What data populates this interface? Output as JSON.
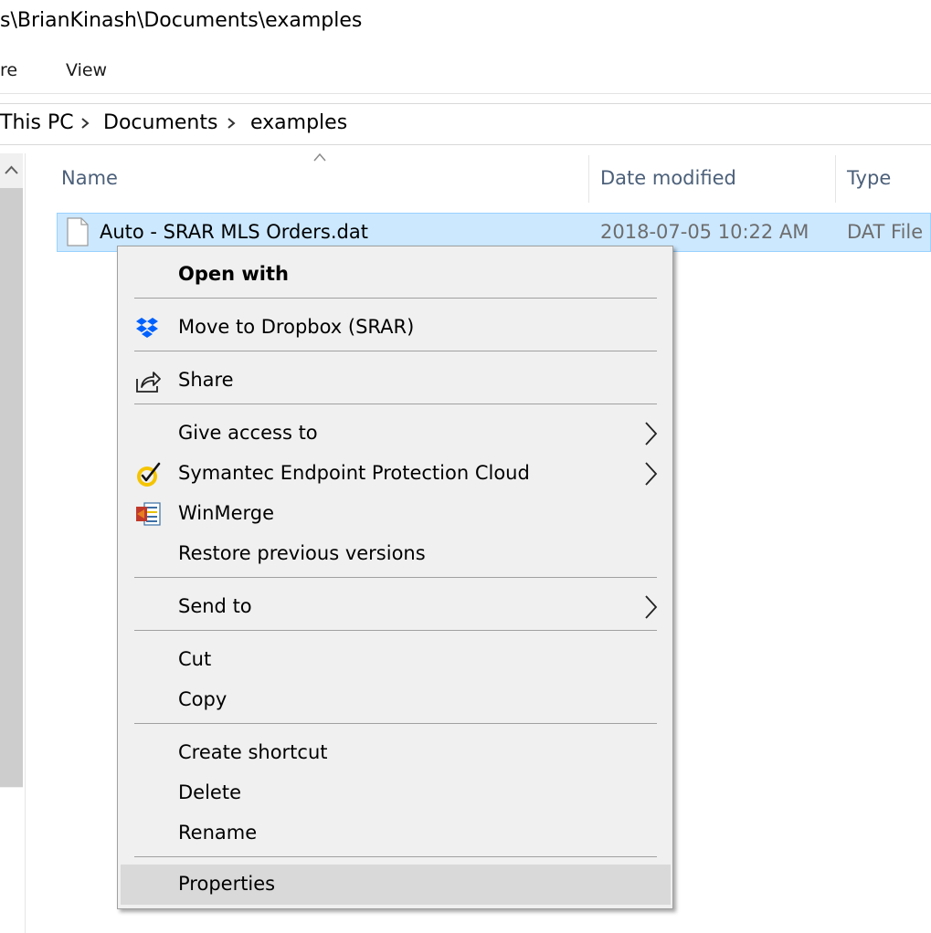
{
  "window": {
    "title": "s\\BrianKinash\\Documents\\examples"
  },
  "ribbon": {
    "tabs": [
      "re",
      "View"
    ]
  },
  "address_bar": {
    "crumbs": [
      "This PC",
      "Documents",
      "examples"
    ]
  },
  "file_list": {
    "columns": [
      "Name",
      "Date modified",
      "Type"
    ],
    "rows": [
      {
        "name": "Auto - SRAR MLS Orders.dat",
        "date_modified": "2018-07-05 10:22 AM",
        "type": "DAT File",
        "selected": true
      }
    ]
  },
  "context_menu": {
    "items": [
      {
        "label": "Open with",
        "bold": true,
        "icon": "",
        "submenu": false
      },
      {
        "label": "Move to Dropbox (SRAR)",
        "icon": "dropbox-icon",
        "submenu": false
      },
      {
        "label": "Share",
        "icon": "share-icon",
        "submenu": false
      },
      {
        "label": "Give access to",
        "icon": "",
        "submenu": true
      },
      {
        "label": "Symantec Endpoint Protection Cloud",
        "icon": "symantec-icon",
        "submenu": true
      },
      {
        "label": "WinMerge",
        "icon": "winmerge-icon",
        "submenu": false
      },
      {
        "label": "Restore previous versions",
        "icon": "",
        "submenu": false
      },
      {
        "label": "Send to",
        "icon": "",
        "submenu": true
      },
      {
        "label": "Cut",
        "icon": "",
        "submenu": false
      },
      {
        "label": "Copy",
        "icon": "",
        "submenu": false
      },
      {
        "label": "Create shortcut",
        "icon": "",
        "submenu": false
      },
      {
        "label": "Delete",
        "icon": "",
        "submenu": false
      },
      {
        "label": "Rename",
        "icon": "",
        "submenu": false
      },
      {
        "label": "Properties",
        "icon": "",
        "submenu": false,
        "highlighted": true
      }
    ]
  },
  "colors": {
    "selection_fill": "#cce8ff",
    "selection_border": "#99d1ff",
    "menu_background": "#f0f0f0",
    "menu_highlight": "#d9d9d9",
    "header_text": "#4c607a",
    "dropbox_blue": "#0061fe",
    "symantec_yellow": "#f5c400"
  }
}
